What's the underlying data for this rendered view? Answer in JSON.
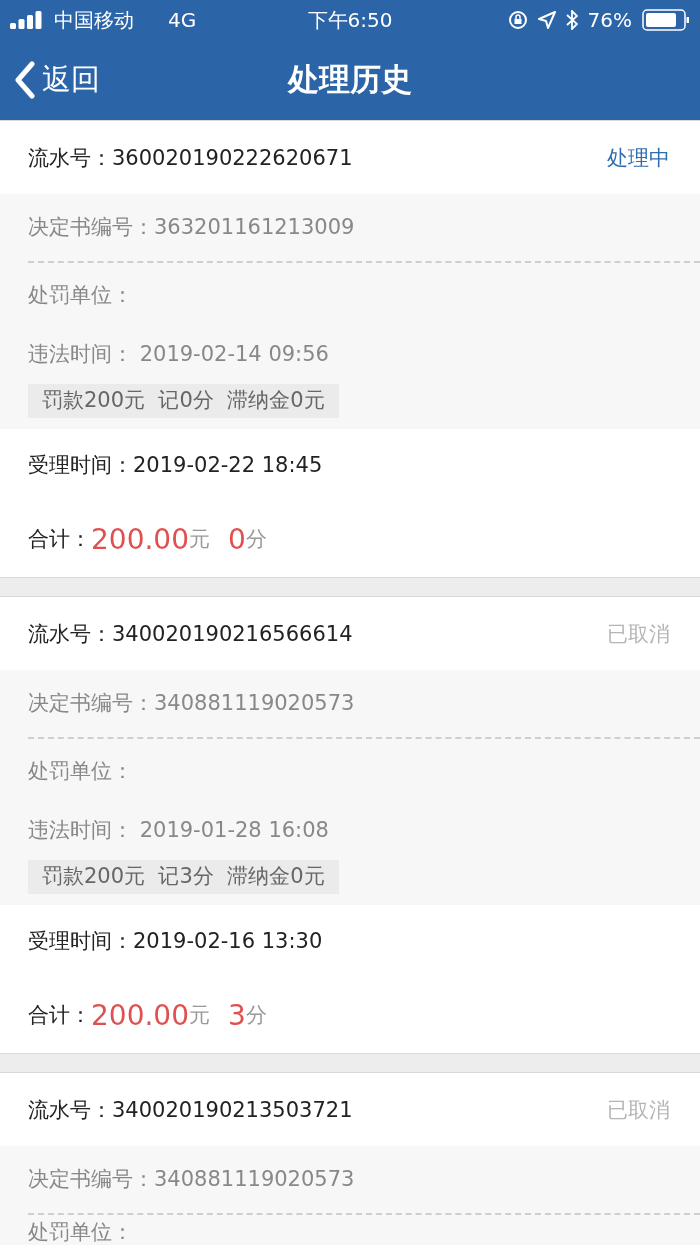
{
  "status_bar": {
    "carrier": "中国移动",
    "network": "4G",
    "time": "下午6:50",
    "battery": "76%"
  },
  "nav": {
    "back": "返回",
    "title": "处理历史"
  },
  "records": [
    {
      "serial_label": "流水号：",
      "serial": "360020190222620671",
      "status": {
        "text": "处理中",
        "kind": "processing"
      },
      "decision_label": "决定书编号：",
      "decision": "363201161213009",
      "unit_label": "处罚单位：",
      "time_label": "违法时间：",
      "time": "2019-02-14 09:56",
      "tag": "罚款200元  记0分  滞纳金0元",
      "accept_label": "受理时间：",
      "accept": "2019-02-22 18:45",
      "total_label": "合计：",
      "amount": "200.00",
      "amount_unit": "元",
      "points": "0",
      "points_unit": "分"
    },
    {
      "serial_label": "流水号：",
      "serial": "340020190216566614",
      "status": {
        "text": "已取消",
        "kind": "cancelled"
      },
      "decision_label": "决定书编号：",
      "decision": "340881119020573",
      "unit_label": "处罚单位：",
      "time_label": "违法时间：",
      "time": "2019-01-28 16:08",
      "tag": "罚款200元  记3分  滞纳金0元",
      "accept_label": "受理时间：",
      "accept": "2019-02-16 13:30",
      "total_label": "合计：",
      "amount": "200.00",
      "amount_unit": "元",
      "points": "3",
      "points_unit": "分"
    },
    {
      "serial_label": "流水号：",
      "serial": "340020190213503721",
      "status": {
        "text": "已取消",
        "kind": "cancelled"
      },
      "decision_label": "决定书编号：",
      "decision": "340881119020573",
      "unit_label": "处罚单位："
    }
  ]
}
